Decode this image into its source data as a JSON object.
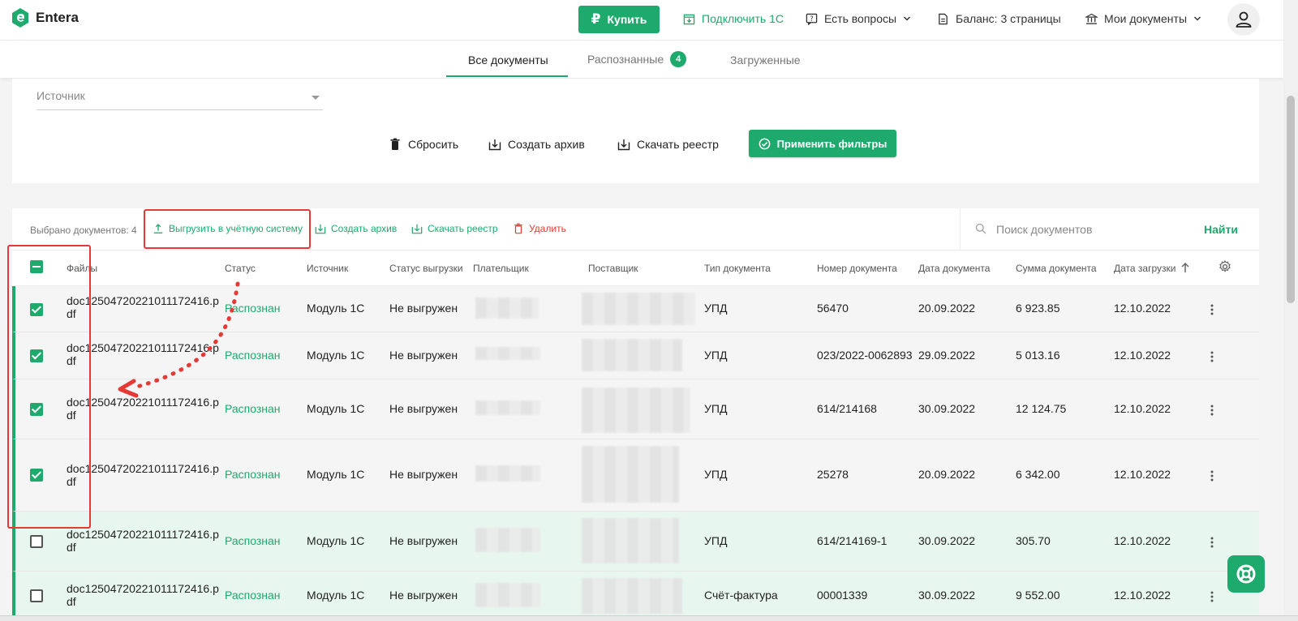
{
  "app": {
    "name": "Entera"
  },
  "topbar": {
    "buy_label": "Купить",
    "buy_icon": "ruble-icon",
    "connect_label": "Подключить 1С",
    "questions_label": "Есть вопросы",
    "balance_label": "Баланс: 3 страницы",
    "mydocs_label": "Мои документы"
  },
  "tabs": [
    {
      "label": "Все документы",
      "active": true
    },
    {
      "label": "Распознанные",
      "badge": "4"
    },
    {
      "label": "Загруженные"
    }
  ],
  "filters": {
    "source_placeholder": "Источник",
    "reset_label": "Сбросить",
    "archive_label": "Создать архив",
    "registry_label": "Скачать реестр",
    "apply_label": "Применить фильтры"
  },
  "toolbar": {
    "selected_count": "Выбрано документов: 4",
    "export_label": "Выгрузить в учётную систему",
    "archive_label": "Создать архив",
    "registry_label": "Скачать реестр",
    "delete_label": "Удалить",
    "search_placeholder": "Поиск документов",
    "search_button": "Найти"
  },
  "table": {
    "columns": [
      "Файлы",
      "Статус",
      "Источник",
      "Статус выгрузки",
      "Плательщик",
      "Поставщик",
      "Тип документа",
      "Номер документа",
      "Дата документа",
      "Сумма документа",
      "Дата загрузки"
    ],
    "rows": [
      {
        "checked": true,
        "file": "doc12504720221011172416.pdf",
        "status": "Распознан",
        "source": "Модуль 1С",
        "export_status": "Не выгружен",
        "doc_type": "УПД",
        "doc_number": "56470",
        "doc_date": "20.09.2022",
        "amount": "6 923.85",
        "upload_date": "12.10.2022"
      },
      {
        "checked": true,
        "file": "doc12504720221011172416.pdf",
        "status": "Распознан",
        "source": "Модуль 1С",
        "export_status": "Не выгружен",
        "doc_type": "УПД",
        "doc_number": "023/2022-0062893",
        "doc_date": "29.09.2022",
        "amount": "5 013.16",
        "upload_date": "12.10.2022"
      },
      {
        "checked": true,
        "file": "doc12504720221011172416.pdf",
        "status": "Распознан",
        "source": "Модуль 1С",
        "export_status": "Не выгружен",
        "doc_type": "УПД",
        "doc_number": "614/214168",
        "doc_date": "30.09.2022",
        "amount": "12 124.75",
        "upload_date": "12.10.2022"
      },
      {
        "checked": true,
        "file": "doc12504720221011172416.pdf",
        "status": "Распознан",
        "source": "Модуль 1С",
        "export_status": "Не выгружен",
        "doc_type": "УПД",
        "doc_number": "25278",
        "doc_date": "20.09.2022",
        "amount": "6 342.00",
        "upload_date": "12.10.2022"
      },
      {
        "checked": false,
        "file": "doc12504720221011172416.pdf",
        "status": "Распознан",
        "source": "Модуль 1С",
        "export_status": "Не выгружен",
        "doc_type": "УПД",
        "doc_number": "614/214169-1",
        "doc_date": "30.09.2022",
        "amount": "305.70",
        "upload_date": "12.10.2022"
      },
      {
        "checked": false,
        "file": "doc12504720221011172416.pdf",
        "status": "Распознан",
        "source": "Модуль 1С",
        "export_status": "Не выгружен",
        "doc_type": "Счёт-фактура",
        "doc_number": "00001339",
        "doc_date": "30.09.2022",
        "amount": "9 552.00",
        "upload_date": "12.10.2022"
      }
    ]
  },
  "colors": {
    "accent": "#1faa6d",
    "danger": "#e53935",
    "annotation": "#e53935"
  }
}
